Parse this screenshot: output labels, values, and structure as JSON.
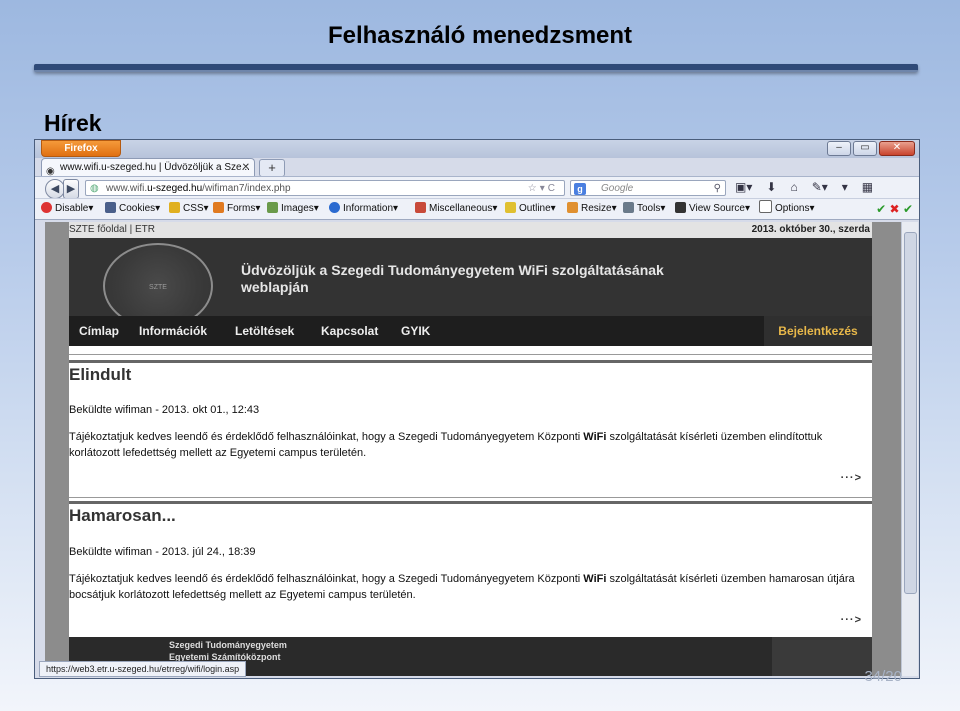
{
  "slide": {
    "title": "Felhasználó menedzsment",
    "section": "Hírek",
    "page_number": "34/20"
  },
  "browser": {
    "app_button": "Firefox",
    "tab_title": "www.wifi.u-szeged.hu | Üdvözöljük a Sze...",
    "url_prefix": "www.wifi.",
    "url_domain": "u-szeged.hu",
    "url_path": "/wifiman7/index.php",
    "search_placeholder": "Google",
    "status_url": "https://web3.etr.u-szeged.hu/etrreg/wifi/login.asp",
    "devbar": {
      "disable": "Disable▾",
      "cookies": "Cookies▾",
      "css": "CSS▾",
      "forms": "Forms▾",
      "images": "Images▾",
      "information": "Information▾",
      "miscellaneous": "Miscellaneous▾",
      "outline": "Outline▾",
      "resize": "Resize▾",
      "tools": "Tools▾",
      "view_source": "View Source▾",
      "options": "Options▾"
    }
  },
  "site": {
    "top_left": "SZTE főoldal | ETR",
    "date": "2013. október 30., szerda",
    "welcome_line1": "Üdvözöljük a Szegedi Tudományegyetem WiFi szolgáltatásának",
    "welcome_line2": "weblapján",
    "menu": {
      "home": "Címlap",
      "info": "Információk",
      "downloads": "Letöltések",
      "contact": "Kapcsolat",
      "faq": "GYIK",
      "login": "Bejelentkezés"
    },
    "articles": [
      {
        "title": "Elindult",
        "byline": "Beküldte wifiman - 2013. okt 01., 12:43",
        "text_before": "Tájékoztatjuk kedves leendő és érdeklődő felhasználóinkat, hogy a Szegedi Tudományegyetem Központi ",
        "text_bold": "WiFi",
        "text_after": " szolgáltatását kísérleti üzemben elindítottuk korlátozott lefedettség mellett az Egyetemi campus területén.",
        "more": "···>"
      },
      {
        "title": "Hamarosan...",
        "byline": "Beküldte wifiman - 2013. júl 24., 18:39",
        "text_before": "Tájékoztatjuk kedves leendő és érdeklődő felhasználóinkat, hogy a Szegedi Tudományegyetem Központi ",
        "text_bold": "WiFi",
        "text_after": " szolgáltatását kísérleti üzemben hamarosan útjára bocsátjuk korlátozott lefedettség mellett az Egyetemi campus területén.",
        "more": "···>"
      }
    ],
    "footer_line1": "Szegedi Tudományegyetem",
    "footer_line2": "Egyetemi Számítóközpont"
  },
  "colors": {
    "accent_orange": "#e07012",
    "login_gold": "#e8b84a",
    "banner_dark": "#333333"
  }
}
